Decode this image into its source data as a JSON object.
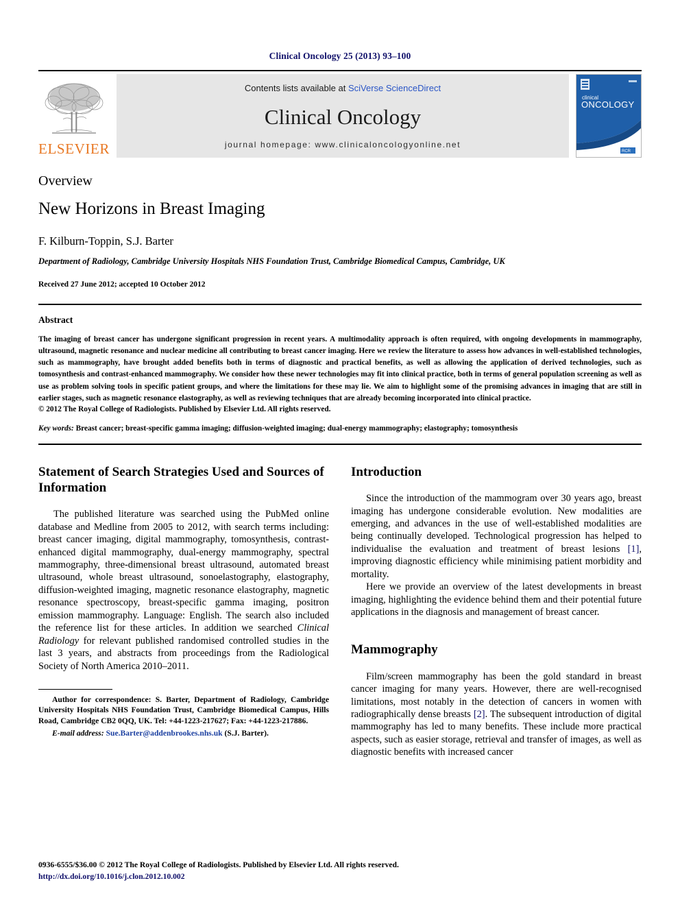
{
  "running_head": "Clinical Oncology 25 (2013) 93–100",
  "masthead": {
    "publisher_name": "ELSEVIER",
    "contents_prefix": "Contents lists available at ",
    "contents_link": "SciVerse ScienceDirect",
    "journal_name": "Clinical Oncology",
    "homepage": "journal homepage: www.clinicaloncologyonline.net",
    "cover": {
      "title_small": "clinical",
      "title_large": "ONCOLOGY",
      "badge": "RCR"
    }
  },
  "article": {
    "doc_type": "Overview",
    "title": "New Horizons in Breast Imaging",
    "authors": "F. Kilburn-Toppin, S.J. Barter",
    "affiliation": "Department of Radiology, Cambridge University Hospitals NHS Foundation Trust, Cambridge Biomedical Campus, Cambridge, UK",
    "dates": "Received 27 June 2012; accepted 10 October 2012"
  },
  "abstract": {
    "label": "Abstract",
    "text": "The imaging of breast cancer has undergone significant progression in recent years. A multimodality approach is often required, with ongoing developments in mammography, ultrasound, magnetic resonance and nuclear medicine all contributing to breast cancer imaging. Here we review the literature to assess how advances in well-established technologies, such as mammography, have brought added benefits both in terms of diagnostic and practical benefits, as well as allowing the application of derived technologies, such as tomosynthesis and contrast-enhanced mammography. We consider how these newer technologies may fit into clinical practice, both in terms of general population screening as well as use as problem solving tools in specific patient groups, and where the limitations for these may lie. We aim to highlight some of the promising advances in imaging that are still in earlier stages, such as magnetic resonance elastography, as well as reviewing techniques that are already becoming incorporated into clinical practice.",
    "copyright": "© 2012 The Royal College of Radiologists. Published by Elsevier Ltd. All rights reserved.",
    "keywords_label": "Key words:",
    "keywords": " Breast cancer; breast-specific gamma imaging; diffusion-weighted imaging; dual-energy mammography; elastography; tomosynthesis"
  },
  "left_column": {
    "heading": "Statement of Search Strategies Used and Sources of Information",
    "para_1a": "The published literature was searched using the PubMed online database and Medline from 2005 to 2012, with search terms including: breast cancer imaging, digital mammography, tomosynthesis, contrast-enhanced digital mammography, dual-energy mammography, spectral mammography, three-dimensional breast ultrasound, automated breast ultrasound, whole breast ultrasound, sonoelastography, elastography, diffusion-weighted imaging, magnetic resonance elastography, magnetic resonance spectroscopy, breast-specific gamma imaging, positron emission mammography. Language: English. The search also included the reference list for these articles. In addition we searched ",
    "para_1_italic": "Clinical Radiology",
    "para_1b": " for relevant published randomised controlled studies in the last 3 years, and abstracts from proceedings from the Radiological Society of North America 2010–2011."
  },
  "right_column": {
    "heading_intro": "Introduction",
    "intro_p1a": "Since the introduction of the mammogram over 30 years ago, breast imaging has undergone considerable evolution. New modalities are emerging, and advances in the use of well-established modalities are being continually developed. Technological progression has helped to individualise the evaluation and treatment of breast lesions ",
    "intro_p1_ref": "[1]",
    "intro_p1b": ", improving diagnostic efficiency while minimising patient morbidity and mortality.",
    "intro_p2": "Here we provide an overview of the latest developments in breast imaging, highlighting the evidence behind them and their potential future applications in the diagnosis and management of breast cancer.",
    "heading_mammography": "Mammography",
    "mammo_p1a": "Film/screen mammography has been the gold standard in breast cancer imaging for many years. However, there are well-recognised limitations, most notably in the detection of cancers in women with radiographically dense breasts ",
    "mammo_p1_ref": "[2]",
    "mammo_p1b": ". The subsequent introduction of digital mammography has led to many benefits. These include more practical aspects, such as easier storage, retrieval and transfer of images, as well as diagnostic benefits with increased cancer"
  },
  "footnote": {
    "correspondence": "Author for correspondence: S. Barter, Department of Radiology, Cambridge University Hospitals NHS Foundation Trust, Cambridge Biomedical Campus, Hills Road, Cambridge CB2 0QQ, UK. Tel: +44-1223-217627; Fax: +44-1223-217886.",
    "email_label": "E-mail address:",
    "email_address": "Sue.Barter@addenbrookes.nhs.uk",
    "email_suffix": " (S.J. Barter)."
  },
  "page_footer": {
    "issn_line": "0936-6555/$36.00 © 2012 The Royal College of Radiologists. Published by Elsevier Ltd. All rights reserved.",
    "doi": "http://dx.doi.org/10.1016/j.clon.2012.10.002"
  },
  "colors": {
    "header_navy": "#10106a",
    "link_blue": "#2b56c6",
    "elsevier_orange": "#e87722",
    "cover_blue": "#1f5fa9",
    "masthead_grey": "#e6e6e6"
  }
}
